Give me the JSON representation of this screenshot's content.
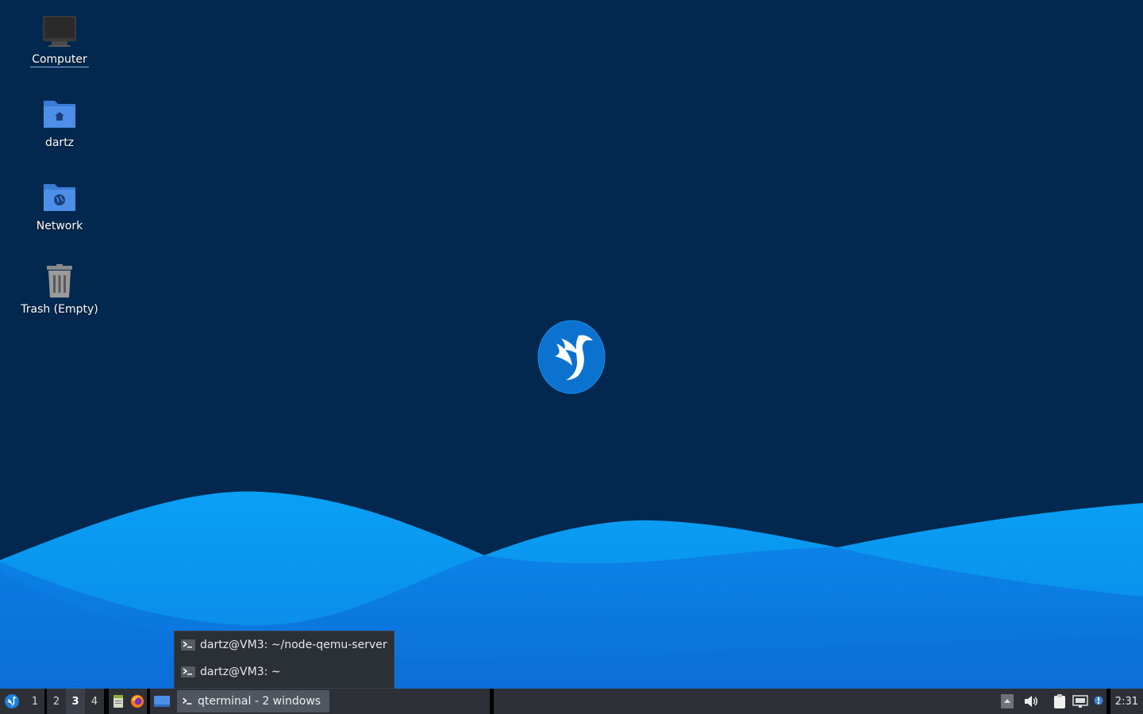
{
  "desktop": {
    "icons": [
      {
        "label": "Computer",
        "icon": "computer-icon"
      },
      {
        "label": "dartz",
        "icon": "home-folder-icon"
      },
      {
        "label": "Network",
        "icon": "network-folder-icon"
      },
      {
        "label": "Trash (Empty)",
        "icon": "trash-icon"
      }
    ],
    "center_logo": "lubuntu-logo-icon"
  },
  "popup": {
    "items": [
      {
        "label": "dartz@VM3: ~/node-qemu-server",
        "icon": "terminal-icon"
      },
      {
        "label": "dartz@VM3: ~",
        "icon": "terminal-icon"
      }
    ]
  },
  "taskbar": {
    "start_icon": "lubuntu-menu-icon",
    "workspaces": [
      "1",
      "2",
      "3",
      "4"
    ],
    "active_workspace": "3",
    "quicklaunch": [
      "file-manager-icon",
      "firefox-icon",
      "show-desktop-icon"
    ],
    "task_label": "qterminal - 2 windows",
    "tray": [
      "tray-expand-icon",
      "volume-icon",
      "clipboard-icon",
      "network-icon",
      "notification-icon"
    ],
    "clock": "2:31"
  },
  "colors": {
    "background": "#02284f",
    "wave_light": "#0a8fe8",
    "wave_dark": "#0c6fd6",
    "taskbar": "#2d3137"
  }
}
